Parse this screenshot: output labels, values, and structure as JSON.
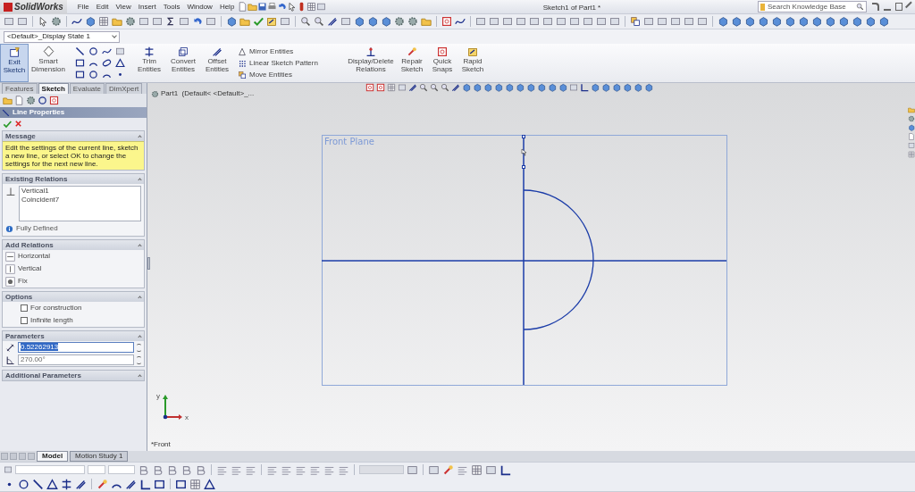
{
  "window": {
    "logo": "SolidWorks",
    "title": "Sketch1 of Part1 *"
  },
  "menu": [
    "File",
    "Edit",
    "View",
    "Insert",
    "Tools",
    "Window",
    "Help"
  ],
  "search": {
    "placeholder": "Search Knowledge Base"
  },
  "display_state": "<Default>_Display State 1",
  "command_manager": {
    "buttons": [
      {
        "label": "Exit Sketch",
        "selected": true
      },
      {
        "label": "Smart Dimension",
        "selected": false
      }
    ],
    "edit_buttons": [
      "Trim Entities",
      "Convert Entities",
      "Offset Entities"
    ],
    "pattern_items": [
      "Mirror Entities",
      "Linear Sketch Pattern",
      "Move Entities"
    ],
    "relation_buttons": [
      "Display/Delete Relations",
      "Repair Sketch",
      "Quick Snaps",
      "Rapid Sketch"
    ]
  },
  "command_tabs": [
    {
      "label": "Features",
      "selected": false
    },
    {
      "label": "Sketch",
      "selected": true
    },
    {
      "label": "Evaluate",
      "selected": false
    },
    {
      "label": "DimXpert",
      "selected": false
    }
  ],
  "property_manager": {
    "title": "Line Properties",
    "message": {
      "heading": "Message",
      "text": "Edit the settings of the current line, sketch a new line, or select OK to change the settings for the next new line."
    },
    "existing_relations": {
      "heading": "Existing Relations",
      "items": [
        "Vertical1",
        "Coincident7"
      ],
      "status": "Fully Defined"
    },
    "add_relations": {
      "heading": "Add Relations",
      "items": [
        "Horizontal",
        "Vertical",
        "Fix"
      ]
    },
    "options": {
      "heading": "Options",
      "items": [
        {
          "label": "For construction",
          "checked": false
        },
        {
          "label": "Infinite length",
          "checked": false
        }
      ]
    },
    "parameters": {
      "heading": "Parameters",
      "fields": [
        {
          "value": "0.52262913",
          "selected": true
        },
        {
          "value": "270.00°",
          "selected": false
        }
      ]
    },
    "additional": {
      "heading": "Additional Parameters"
    }
  },
  "feature_tree": {
    "label": "Part1  (Default< <Default>_..."
  },
  "graphics": {
    "plane_label": "Front Plane",
    "view_label": "*Front",
    "axis_x": "x",
    "axis_y": "y"
  },
  "bottom_tabs": [
    {
      "label": "Model",
      "selected": true
    },
    {
      "label": "Motion Study 1",
      "selected": false
    }
  ]
}
